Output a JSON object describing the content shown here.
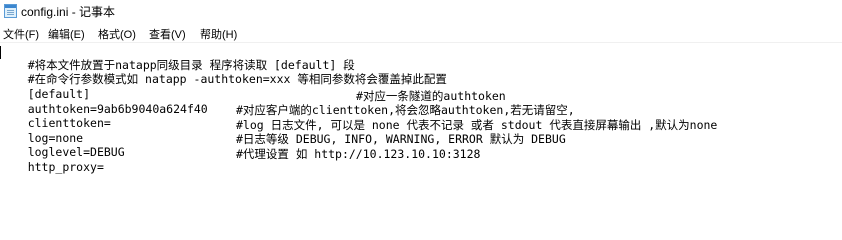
{
  "window": {
    "title": "config.ini - 记事本",
    "icon": "notepad-icon"
  },
  "menu": [
    "文件(F)",
    "编辑(E)",
    "格式(O)",
    "查看(V)",
    "帮助(H)"
  ],
  "editor": {
    "lines": [
      {
        "text": "#将本文件放置于natapp同级目录 程序将读取 [default] 段",
        "comment": ""
      },
      {
        "text": "#在命令行参数模式如 natapp -authtoken=xxx 等相同参数将会覆盖掉此配置",
        "comment": ""
      },
      {
        "text": "[default]",
        "comment": ""
      },
      {
        "text": "authtoken=9ab6b9040a624f40",
        "comment": "#对应一条隧道的authtoken"
      },
      {
        "text": "clienttoken=",
        "comment": "#对应客户端的clienttoken,将会忽略authtoken,若无请留空,"
      },
      {
        "text": "log=none",
        "comment": "#log 日志文件, 可以是 none 代表不记录 或者 stdout 代表直接屏幕输出 ,默认为none"
      },
      {
        "text": "loglevel=DEBUG",
        "comment": "#日志等级 DEBUG, INFO, WARNING, ERROR 默认为 DEBUG"
      },
      {
        "text": "http_proxy=",
        "comment": "#代理设置 如 http://10.123.10.10:3128"
      }
    ]
  }
}
